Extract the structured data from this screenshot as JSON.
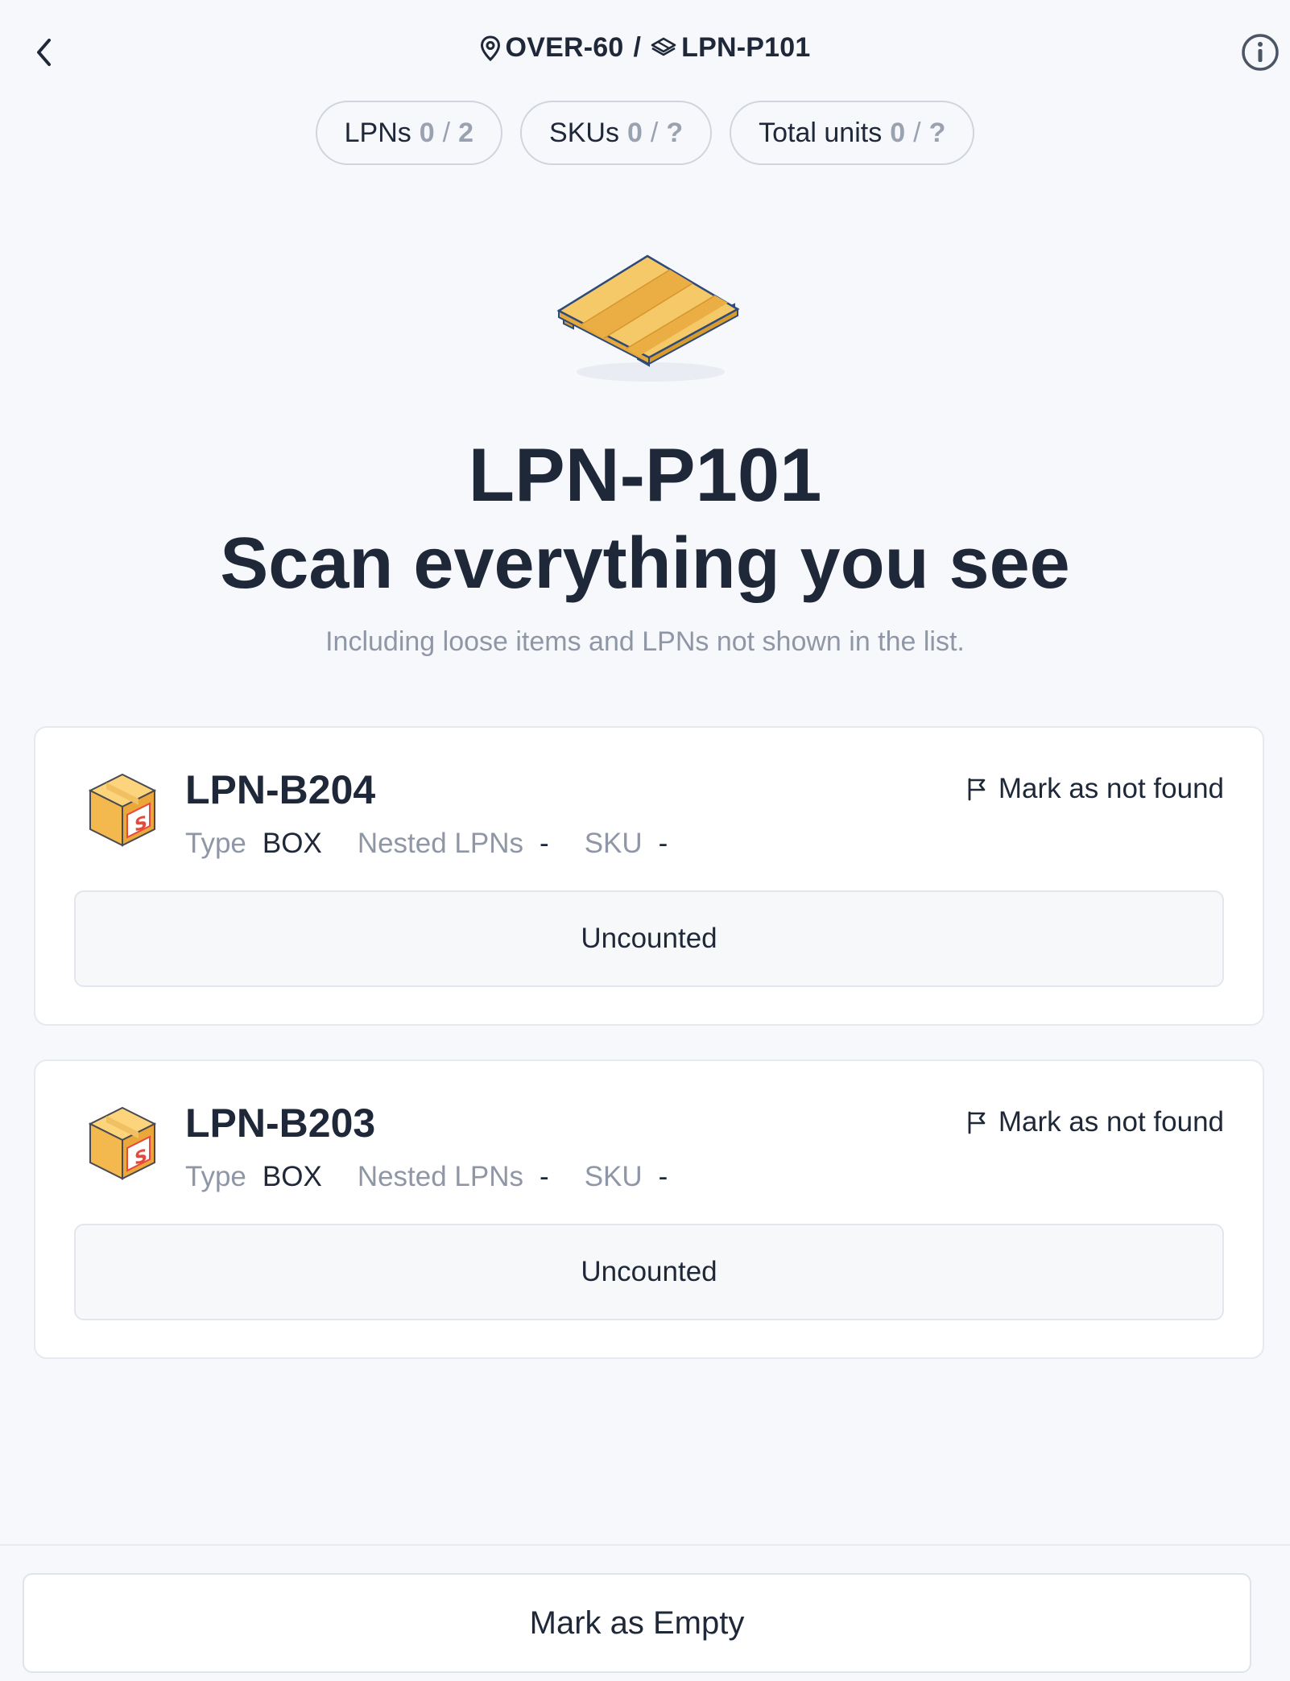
{
  "header": {
    "location": "OVER-60",
    "separator": "/",
    "lpn": "LPN-P101",
    "back_icon": "chevron-left-icon",
    "info_icon": "info-icon"
  },
  "stats": [
    {
      "label": "LPNs",
      "count": "0",
      "total": "2"
    },
    {
      "label": "SKUs",
      "count": "0",
      "total": "?"
    },
    {
      "label": "Total units",
      "count": "0",
      "total": "?"
    }
  ],
  "hero": {
    "title": "LPN-P101",
    "heading": "Scan everything you see",
    "subtitle": "Including loose items and LPNs not shown in the list."
  },
  "labels": {
    "type": "Type",
    "nested": "Nested LPNs",
    "sku": "SKU",
    "mark_not_found": "Mark as not found",
    "uncounted": "Uncounted"
  },
  "lpns": [
    {
      "id": "LPN-B204",
      "type": "BOX",
      "nested": "-",
      "sku": "-",
      "status": "Uncounted",
      "action": "Mark as not found"
    },
    {
      "id": "LPN-B203",
      "type": "BOX",
      "nested": "-",
      "sku": "-",
      "status": "Uncounted",
      "action": "Mark as not found"
    }
  ],
  "footer": {
    "mark_empty": "Mark as Empty"
  },
  "colors": {
    "text": "#1f2838",
    "muted": "#8f97a6",
    "background": "#f7f8fb",
    "pallet_wood": "#f3c25a",
    "box_orange": "#f4b94e",
    "accent_red": "#e8483b"
  }
}
